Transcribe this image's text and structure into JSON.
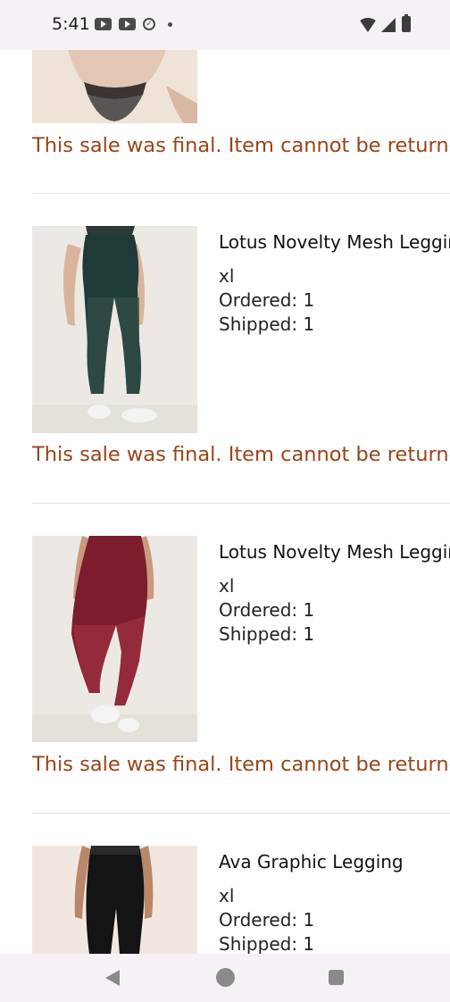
{
  "status_bar": {
    "time": "5:41"
  },
  "colors": {
    "final_note": "#9a4419",
    "divider": "#e4e4e4",
    "bars": "#f6f1f6"
  },
  "items": [
    {
      "image": "panty-product-image",
      "final_note": "This sale was final. Item cannot be returned."
    },
    {
      "image": "green-mesh-legging-image",
      "title": "Lotus Novelty Mesh Legging",
      "size": "xl",
      "ordered": "Ordered: 1",
      "shipped": "Shipped: 1",
      "final_note": "This sale was final. Item cannot be returned."
    },
    {
      "image": "burgundy-mesh-legging-image",
      "title": "Lotus Novelty Mesh Legging",
      "size": "xl",
      "ordered": "Ordered: 1",
      "shipped": "Shipped: 1",
      "final_note": "This sale was final. Item cannot be returned."
    },
    {
      "image": "black-graphic-legging-image",
      "title": "Ava Graphic Legging",
      "size": "xl",
      "ordered": "Ordered: 1",
      "shipped": "Shipped: 1"
    }
  ]
}
